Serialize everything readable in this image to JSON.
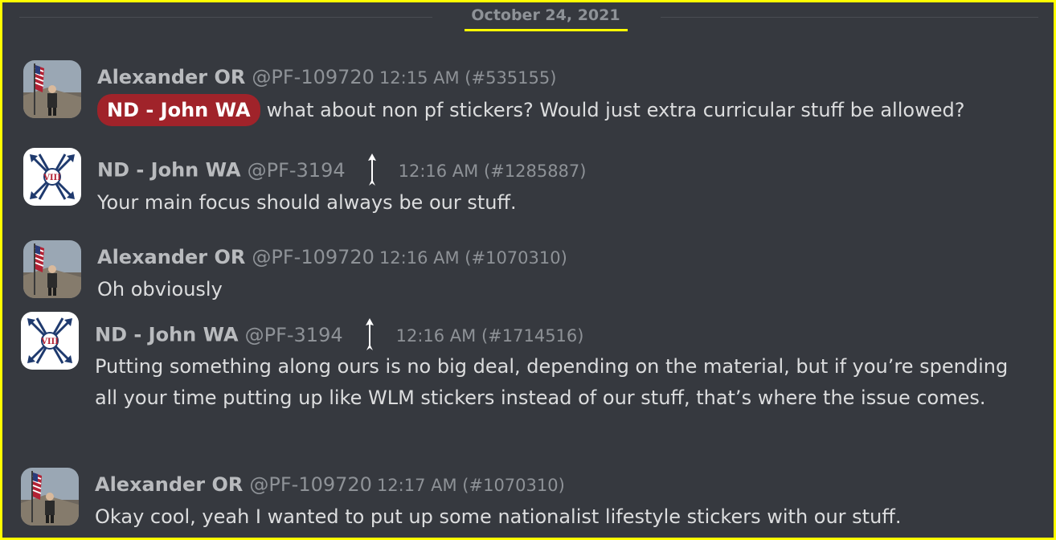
{
  "date_divider": "October 24, 2021",
  "messages": [
    {
      "username": "Alexander OR",
      "handle": "@PF-109720",
      "timestamp": "12:15 AM (#535155)",
      "mention": "ND - John WA",
      "text": "what about non pf stickers? Would just extra curricular stuff be allowed?"
    },
    {
      "username": "ND - John WA",
      "handle": "@PF-3194",
      "timestamp": "12:16 AM (#1285887)",
      "text": "Your main focus should always be our stuff."
    },
    {
      "username": "Alexander OR",
      "handle": "@PF-109720",
      "timestamp": "12:16 AM (#1070310)",
      "text": "Oh obviously"
    },
    {
      "username": "ND - John WA",
      "handle": "@PF-3194",
      "timestamp": "12:16 AM (#1714516)",
      "text": "Putting something along ours is no big deal, depending on the material, but if you’re spending all your time putting up like WLM stickers instead of our stuff, that’s where the issue comes."
    },
    {
      "username": "Alexander OR",
      "handle": "@PF-109720",
      "timestamp": "12:17 AM (#1070310)",
      "text": "Okay cool, yeah I wanted to put up some nationalist lifestyle stickers with our stuff."
    }
  ],
  "icons": {
    "avatar_alexander": "flag-portrait-avatar",
    "avatar_john": "arrows-emblem-avatar",
    "role_badge": "arrow-up-icon"
  },
  "colors": {
    "background": "#36393f",
    "highlight_border": "#ffff00",
    "mention_bg": "#a0232a"
  }
}
